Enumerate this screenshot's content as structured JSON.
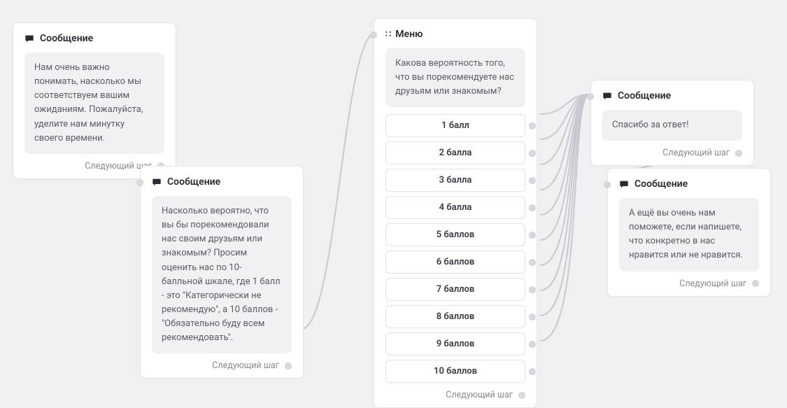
{
  "labels": {
    "message": "Сообщение",
    "menu": "Меню",
    "nextStep": "Следующий шаг"
  },
  "nodes": {
    "msg1": {
      "body": "Нам очень важно понимать, насколько мы соответствуем вашим ожиданиям. Пожалуйста, уделите нам минутку своего времени."
    },
    "msg2": {
      "body": "Насколько вероятно, что вы бы порекомендовали нас своим друзьям или знакомым? Просим оценить нас по 10-балльной шкале, где 1 балл - это \"Категорически не рекомендую\", а 10 баллов - \"Обязательно буду всем рекомендовать\"."
    },
    "menu": {
      "prompt": "Какова вероятность того, что вы порекомендуете нас друзьям или знакомым?",
      "options": [
        "1 балл",
        "2 балла",
        "3 балла",
        "4 балла",
        "5 баллов",
        "6 баллов",
        "7 баллов",
        "8 баллов",
        "9 баллов",
        "10 баллов"
      ]
    },
    "msg3": {
      "body": "Спасибо за ответ!"
    },
    "msg4": {
      "body": "А ещё вы очень нам поможете, если напишете, что конкретно в нас нравится или не нравится."
    }
  }
}
